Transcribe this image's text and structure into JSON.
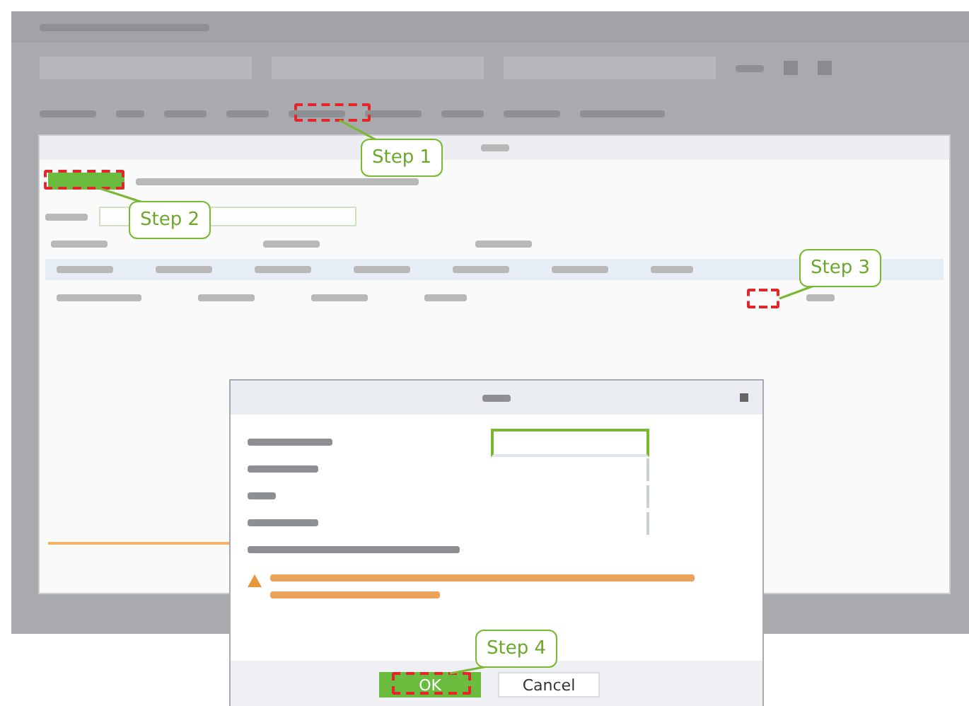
{
  "steps": [
    {
      "label": "Step 1"
    },
    {
      "label": "Step 2"
    },
    {
      "label": "Step 3"
    },
    {
      "label": "Step 4"
    }
  ],
  "edit_dialog": {
    "buttons": [
      {
        "label": "OK",
        "kind": "primary"
      },
      {
        "label": "Cancel",
        "kind": "secondary"
      }
    ]
  }
}
